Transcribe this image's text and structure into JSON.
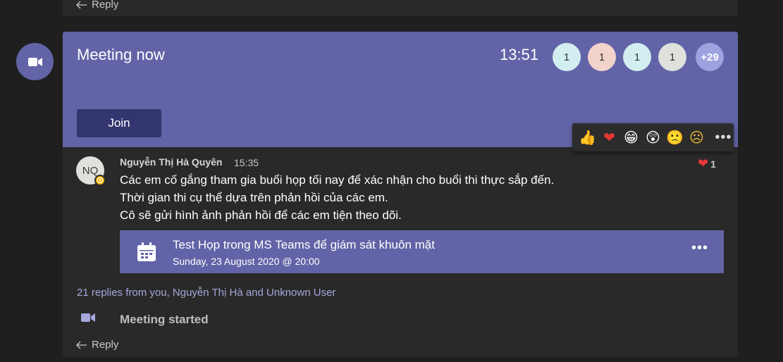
{
  "top_card": {
    "reply_label": "Reply"
  },
  "meeting": {
    "title": "Meeting now",
    "time": "13:51",
    "participants": [
      {
        "label": "1",
        "color": "#d3eef0"
      },
      {
        "label": "1",
        "color": "#f2d3cc"
      },
      {
        "label": "1",
        "color": "#d3eef0"
      },
      {
        "label": "1",
        "color": "#dfe2dc"
      },
      {
        "label": "+29",
        "color": "#9ea2de"
      }
    ],
    "join_label": "Join",
    "accent_color": "#6264a7"
  },
  "reactions": {
    "items": [
      "thumbs-up",
      "heart",
      "laugh",
      "surprised",
      "sad",
      "angry"
    ],
    "glyphs": [
      "👍",
      "❤",
      "😁",
      "😲",
      "🙁",
      "☹"
    ],
    "more_label": "•••"
  },
  "message": {
    "avatar_initials": "NQ",
    "author": "Nguyễn Thị Hà Quyên",
    "time": "15:35",
    "reaction_count": "1",
    "lines": [
      "Các em cố gắng tham gia buổi họp tối nay để xác nhận cho buổi thi thực sắp đến.",
      "Thời gian thi cụ thể dựa trên phản hồi của các em.",
      "Cô sẽ gửi hình ảnh phản hồi để các em tiện theo dõi."
    ],
    "event": {
      "title": "Test Họp trong MS Teams để giám sát khuôn mặt",
      "date": "Sunday, 23 August 2020 @ 20:00",
      "more_label": "•••"
    },
    "replies_summary": "21 replies from you, Nguyễn Thị Hà and Unknown User",
    "meeting_started": "Meeting started",
    "reply_label": "Reply"
  }
}
